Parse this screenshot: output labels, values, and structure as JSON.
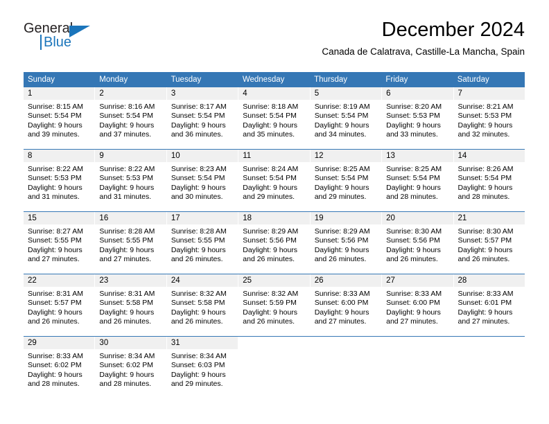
{
  "brand": {
    "line1": "General",
    "line2": "Blue",
    "accent_color": "#1b75bb",
    "triangle_icon": "triangle-icon"
  },
  "header": {
    "title": "December 2024",
    "subtitle": "Canada de Calatrava, Castille-La Mancha, Spain"
  },
  "calendar": {
    "header_bg": "#3577b5",
    "weekdays": [
      "Sunday",
      "Monday",
      "Tuesday",
      "Wednesday",
      "Thursday",
      "Friday",
      "Saturday"
    ],
    "weeks": [
      [
        {
          "day": "1",
          "sunrise": "Sunrise: 8:15 AM",
          "sunset": "Sunset: 5:54 PM",
          "daylight1": "Daylight: 9 hours",
          "daylight2": "and 39 minutes."
        },
        {
          "day": "2",
          "sunrise": "Sunrise: 8:16 AM",
          "sunset": "Sunset: 5:54 PM",
          "daylight1": "Daylight: 9 hours",
          "daylight2": "and 37 minutes."
        },
        {
          "day": "3",
          "sunrise": "Sunrise: 8:17 AM",
          "sunset": "Sunset: 5:54 PM",
          "daylight1": "Daylight: 9 hours",
          "daylight2": "and 36 minutes."
        },
        {
          "day": "4",
          "sunrise": "Sunrise: 8:18 AM",
          "sunset": "Sunset: 5:54 PM",
          "daylight1": "Daylight: 9 hours",
          "daylight2": "and 35 minutes."
        },
        {
          "day": "5",
          "sunrise": "Sunrise: 8:19 AM",
          "sunset": "Sunset: 5:54 PM",
          "daylight1": "Daylight: 9 hours",
          "daylight2": "and 34 minutes."
        },
        {
          "day": "6",
          "sunrise": "Sunrise: 8:20 AM",
          "sunset": "Sunset: 5:53 PM",
          "daylight1": "Daylight: 9 hours",
          "daylight2": "and 33 minutes."
        },
        {
          "day": "7",
          "sunrise": "Sunrise: 8:21 AM",
          "sunset": "Sunset: 5:53 PM",
          "daylight1": "Daylight: 9 hours",
          "daylight2": "and 32 minutes."
        }
      ],
      [
        {
          "day": "8",
          "sunrise": "Sunrise: 8:22 AM",
          "sunset": "Sunset: 5:53 PM",
          "daylight1": "Daylight: 9 hours",
          "daylight2": "and 31 minutes."
        },
        {
          "day": "9",
          "sunrise": "Sunrise: 8:22 AM",
          "sunset": "Sunset: 5:53 PM",
          "daylight1": "Daylight: 9 hours",
          "daylight2": "and 31 minutes."
        },
        {
          "day": "10",
          "sunrise": "Sunrise: 8:23 AM",
          "sunset": "Sunset: 5:54 PM",
          "daylight1": "Daylight: 9 hours",
          "daylight2": "and 30 minutes."
        },
        {
          "day": "11",
          "sunrise": "Sunrise: 8:24 AM",
          "sunset": "Sunset: 5:54 PM",
          "daylight1": "Daylight: 9 hours",
          "daylight2": "and 29 minutes."
        },
        {
          "day": "12",
          "sunrise": "Sunrise: 8:25 AM",
          "sunset": "Sunset: 5:54 PM",
          "daylight1": "Daylight: 9 hours",
          "daylight2": "and 29 minutes."
        },
        {
          "day": "13",
          "sunrise": "Sunrise: 8:25 AM",
          "sunset": "Sunset: 5:54 PM",
          "daylight1": "Daylight: 9 hours",
          "daylight2": "and 28 minutes."
        },
        {
          "day": "14",
          "sunrise": "Sunrise: 8:26 AM",
          "sunset": "Sunset: 5:54 PM",
          "daylight1": "Daylight: 9 hours",
          "daylight2": "and 28 minutes."
        }
      ],
      [
        {
          "day": "15",
          "sunrise": "Sunrise: 8:27 AM",
          "sunset": "Sunset: 5:55 PM",
          "daylight1": "Daylight: 9 hours",
          "daylight2": "and 27 minutes."
        },
        {
          "day": "16",
          "sunrise": "Sunrise: 8:28 AM",
          "sunset": "Sunset: 5:55 PM",
          "daylight1": "Daylight: 9 hours",
          "daylight2": "and 27 minutes."
        },
        {
          "day": "17",
          "sunrise": "Sunrise: 8:28 AM",
          "sunset": "Sunset: 5:55 PM",
          "daylight1": "Daylight: 9 hours",
          "daylight2": "and 26 minutes."
        },
        {
          "day": "18",
          "sunrise": "Sunrise: 8:29 AM",
          "sunset": "Sunset: 5:56 PM",
          "daylight1": "Daylight: 9 hours",
          "daylight2": "and 26 minutes."
        },
        {
          "day": "19",
          "sunrise": "Sunrise: 8:29 AM",
          "sunset": "Sunset: 5:56 PM",
          "daylight1": "Daylight: 9 hours",
          "daylight2": "and 26 minutes."
        },
        {
          "day": "20",
          "sunrise": "Sunrise: 8:30 AM",
          "sunset": "Sunset: 5:56 PM",
          "daylight1": "Daylight: 9 hours",
          "daylight2": "and 26 minutes."
        },
        {
          "day": "21",
          "sunrise": "Sunrise: 8:30 AM",
          "sunset": "Sunset: 5:57 PM",
          "daylight1": "Daylight: 9 hours",
          "daylight2": "and 26 minutes."
        }
      ],
      [
        {
          "day": "22",
          "sunrise": "Sunrise: 8:31 AM",
          "sunset": "Sunset: 5:57 PM",
          "daylight1": "Daylight: 9 hours",
          "daylight2": "and 26 minutes."
        },
        {
          "day": "23",
          "sunrise": "Sunrise: 8:31 AM",
          "sunset": "Sunset: 5:58 PM",
          "daylight1": "Daylight: 9 hours",
          "daylight2": "and 26 minutes."
        },
        {
          "day": "24",
          "sunrise": "Sunrise: 8:32 AM",
          "sunset": "Sunset: 5:58 PM",
          "daylight1": "Daylight: 9 hours",
          "daylight2": "and 26 minutes."
        },
        {
          "day": "25",
          "sunrise": "Sunrise: 8:32 AM",
          "sunset": "Sunset: 5:59 PM",
          "daylight1": "Daylight: 9 hours",
          "daylight2": "and 26 minutes."
        },
        {
          "day": "26",
          "sunrise": "Sunrise: 8:33 AM",
          "sunset": "Sunset: 6:00 PM",
          "daylight1": "Daylight: 9 hours",
          "daylight2": "and 27 minutes."
        },
        {
          "day": "27",
          "sunrise": "Sunrise: 8:33 AM",
          "sunset": "Sunset: 6:00 PM",
          "daylight1": "Daylight: 9 hours",
          "daylight2": "and 27 minutes."
        },
        {
          "day": "28",
          "sunrise": "Sunrise: 8:33 AM",
          "sunset": "Sunset: 6:01 PM",
          "daylight1": "Daylight: 9 hours",
          "daylight2": "and 27 minutes."
        }
      ],
      [
        {
          "day": "29",
          "sunrise": "Sunrise: 8:33 AM",
          "sunset": "Sunset: 6:02 PM",
          "daylight1": "Daylight: 9 hours",
          "daylight2": "and 28 minutes."
        },
        {
          "day": "30",
          "sunrise": "Sunrise: 8:34 AM",
          "sunset": "Sunset: 6:02 PM",
          "daylight1": "Daylight: 9 hours",
          "daylight2": "and 28 minutes."
        },
        {
          "day": "31",
          "sunrise": "Sunrise: 8:34 AM",
          "sunset": "Sunset: 6:03 PM",
          "daylight1": "Daylight: 9 hours",
          "daylight2": "and 29 minutes."
        },
        {
          "day": "",
          "sunrise": "",
          "sunset": "",
          "daylight1": "",
          "daylight2": ""
        },
        {
          "day": "",
          "sunrise": "",
          "sunset": "",
          "daylight1": "",
          "daylight2": ""
        },
        {
          "day": "",
          "sunrise": "",
          "sunset": "",
          "daylight1": "",
          "daylight2": ""
        },
        {
          "day": "",
          "sunrise": "",
          "sunset": "",
          "daylight1": "",
          "daylight2": ""
        }
      ]
    ]
  }
}
